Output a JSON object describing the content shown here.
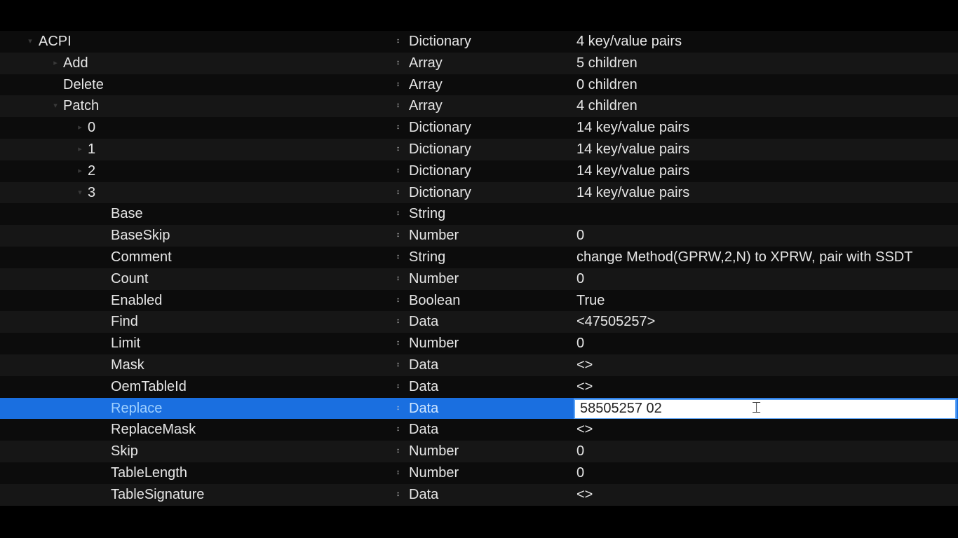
{
  "outline": {
    "rows": [
      {
        "key": "ACPI",
        "type": "Dictionary",
        "value": "4 key/value pairs",
        "disclosure": "expanded"
      },
      {
        "key": "Add",
        "type": "Array",
        "value": "5 children",
        "disclosure": "collapsed"
      },
      {
        "key": "Delete",
        "type": "Array",
        "value": "0 children",
        "disclosure": ""
      },
      {
        "key": "Patch",
        "type": "Array",
        "value": "4 children",
        "disclosure": "expanded"
      },
      {
        "key": "0",
        "type": "Dictionary",
        "value": "14 key/value pairs",
        "disclosure": "collapsed"
      },
      {
        "key": "1",
        "type": "Dictionary",
        "value": "14 key/value pairs",
        "disclosure": "collapsed"
      },
      {
        "key": "2",
        "type": "Dictionary",
        "value": "14 key/value pairs",
        "disclosure": "collapsed"
      },
      {
        "key": "3",
        "type": "Dictionary",
        "value": "14 key/value pairs",
        "disclosure": "expanded"
      },
      {
        "key": "Base",
        "type": "String",
        "value": "",
        "disclosure": ""
      },
      {
        "key": "BaseSkip",
        "type": "Number",
        "value": "0",
        "disclosure": ""
      },
      {
        "key": "Comment",
        "type": "String",
        "value": "change Method(GPRW,2,N) to XPRW, pair with SSDT",
        "disclosure": ""
      },
      {
        "key": "Count",
        "type": "Number",
        "value": "0",
        "disclosure": ""
      },
      {
        "key": "Enabled",
        "type": "Boolean",
        "value": "True",
        "disclosure": ""
      },
      {
        "key": "Find",
        "type": "Data",
        "value": "<47505257>",
        "disclosure": ""
      },
      {
        "key": "Limit",
        "type": "Number",
        "value": "0",
        "disclosure": ""
      },
      {
        "key": "Mask",
        "type": "Data",
        "value": "<>",
        "disclosure": ""
      },
      {
        "key": "OemTableId",
        "type": "Data",
        "value": "<>",
        "disclosure": ""
      },
      {
        "key": "Replace",
        "type": "Data",
        "value": "58505257 02",
        "disclosure": "",
        "selected": true,
        "editing": true
      },
      {
        "key": "ReplaceMask",
        "type": "Data",
        "value": "<>",
        "disclosure": ""
      },
      {
        "key": "Skip",
        "type": "Number",
        "value": "0",
        "disclosure": ""
      },
      {
        "key": "TableLength",
        "type": "Number",
        "value": "0",
        "disclosure": ""
      },
      {
        "key": "TableSignature",
        "type": "Data",
        "value": "<>",
        "disclosure": ""
      }
    ]
  },
  "icons": {
    "stepper": "up-down-stepper-icon",
    "disclosure_expanded": "chevron-down-icon",
    "disclosure_collapsed": "chevron-right-icon",
    "cursor": "text-cursor-icon"
  },
  "colors": {
    "background": "#000000",
    "row_odd": "#0c0c0c",
    "row_even": "#161616",
    "selection": "#1a6fe0",
    "text": "#e6e6e6"
  }
}
